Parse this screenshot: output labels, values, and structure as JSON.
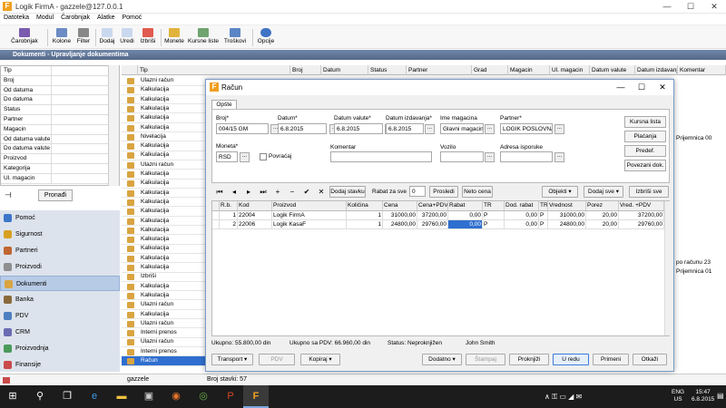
{
  "app": {
    "title": "Logik FirmA - gazzele@127.0.0.1",
    "logo_letter": "F"
  },
  "menu": [
    "Datoteka",
    "Modul",
    "Čarobnjak",
    "Alatke",
    "Pomoć"
  ],
  "toolbar": [
    "Čarobnjak",
    "Kolone",
    "Filter",
    "Dodaj",
    "Uredi",
    "Izbriši",
    "Monete",
    "Kursne liste",
    "Troškovi",
    "Opcije"
  ],
  "module_title": "Dokumenti - Upravljanje dokumentima",
  "filters": [
    "Tip",
    "Broj",
    "Od datuma",
    "Do datuma",
    "Status",
    "Partner",
    "Magacin",
    "Od datuma valute",
    "Do datuma valute",
    "Proizvod",
    "Kategorija",
    "Ul. magacin"
  ],
  "pronadji": "Pronađi",
  "nav": [
    "Pomoć",
    "Sigurnost",
    "Partneri",
    "Proizvodi",
    "Dokumenti",
    "Banka",
    "PDV",
    "CRM",
    "Proizvodnja",
    "Finansije"
  ],
  "nav_selected": "Dokumenti",
  "grid": {
    "columns": [
      "Tip",
      "Broj",
      "Datum",
      "Status",
      "Partner",
      "Grad",
      "Magacin",
      "Ul. magacin",
      "Datum valute",
      "Datum izdavanja",
      "Komentar"
    ],
    "rows": [
      "Ulazni račun",
      "Kalkulacija",
      "Kalkulacija",
      "Kalkulacija",
      "Kalkulacija",
      "Kalkulacija",
      "Nivelacija",
      "Kalkulacija",
      "Kalkulacija",
      "Ulazni račun",
      "Kalkulacija",
      "Kalkulacija",
      "Kalkulacija",
      "Kalkulacija",
      "Kalkulacija",
      "Kalkulacija",
      "Kalkulacija",
      "Kalkulacija",
      "Kalkulacija",
      "Kalkulacija",
      "Kalkulacija",
      "Izbriši",
      "Kalkulacija",
      "Kalkulacija",
      "Ulazni račun",
      "Kalkulacija",
      "Ulazni račun",
      "Interni prenos",
      "Ulazni račun",
      "Interni prenos",
      "Račun"
    ],
    "selected_index": 30,
    "right_clips": [
      "Prijemnica 00",
      "po računu 23",
      "Prijemnica 01"
    ]
  },
  "status": {
    "user": "gazzele",
    "count_label": "Broj stavki: 57"
  },
  "taskbar": {
    "lang": "ENG",
    "region": "US",
    "time": "15:47",
    "date": "6.8.2015"
  },
  "dialog": {
    "title": "Račun",
    "tab": "Opšte",
    "fields": {
      "broj_label": "Broj*",
      "broj": "004/15 GM",
      "datum_label": "Datum*",
      "datum": "6.8.2015",
      "datum_valute_label": "Datum valute*",
      "datum_valute": "6.8.2015",
      "datum_izdavanja_label": "Datum izdavanja*",
      "datum_izdavanja": "6.8.2015",
      "ime_magacina_label": "Ime magacina",
      "ime_magacina": "Glavni magacin",
      "partner_label": "Partner*",
      "partner": "LOGIK POSLOVNA F",
      "moneta_label": "Moneta*",
      "moneta": "RSD",
      "povracaj": "Povraćaj",
      "komentar_label": "Komentar",
      "komentar": "",
      "vozilo_label": "Vozilo",
      "vozilo": "",
      "adresa_label": "Adresa isporuke",
      "adresa": ""
    },
    "side_buttons": [
      "Kursna lista",
      "Plaćanja",
      "Predef.",
      "Povezani dok."
    ],
    "line_toolbar": {
      "dodaj_stavku": "Dodaj stavku",
      "rabat_label": "Rabat za sve",
      "rabat_value": "0",
      "prosledi": "Prosledi",
      "neto_cena": "Neto cena",
      "objekti": "Objekti",
      "dodaj_sve": "Dodaj sve",
      "izbrisi_sve": "Izbriši sve"
    },
    "line_columns": [
      "R.b.",
      "Kod",
      "Proizvod",
      "Količina",
      "Cena",
      "Cena+PDV",
      "Rabat",
      "TR",
      "Dod. rabat",
      "TR",
      "Vrednost",
      "Porez",
      "Vred. +PDV"
    ],
    "lines": [
      [
        "1",
        "22004",
        "Logik FirmA",
        "1",
        "31000,00",
        "37200,00",
        "0,00",
        "P",
        "0,00",
        "P",
        "31000,00",
        "20,00",
        "37200,00"
      ],
      [
        "2",
        "22006",
        "Logik KasaF",
        "1",
        "24800,00",
        "29760,00",
        "0,00",
        "P",
        "0,00",
        "P",
        "24800,00",
        "20,00",
        "29760,00"
      ]
    ],
    "totals": {
      "ukupno": "Ukupno: 55.800,00 din",
      "ukupno_pdv": "Ukupno sa PDV: 66.960,00 din",
      "status": "Status:  Neproknjižen",
      "user": "John Smith"
    },
    "footer_buttons": {
      "transport": "Transport",
      "pdv": "PDV",
      "kopiraj": "Kopiraj",
      "dodatno": "Dodatno",
      "stampaj": "Štampaj",
      "proknjizi": "Proknjiži",
      "u_redu": "U redu",
      "primeni": "Primeni",
      "otkazi": "Otkaži"
    }
  }
}
